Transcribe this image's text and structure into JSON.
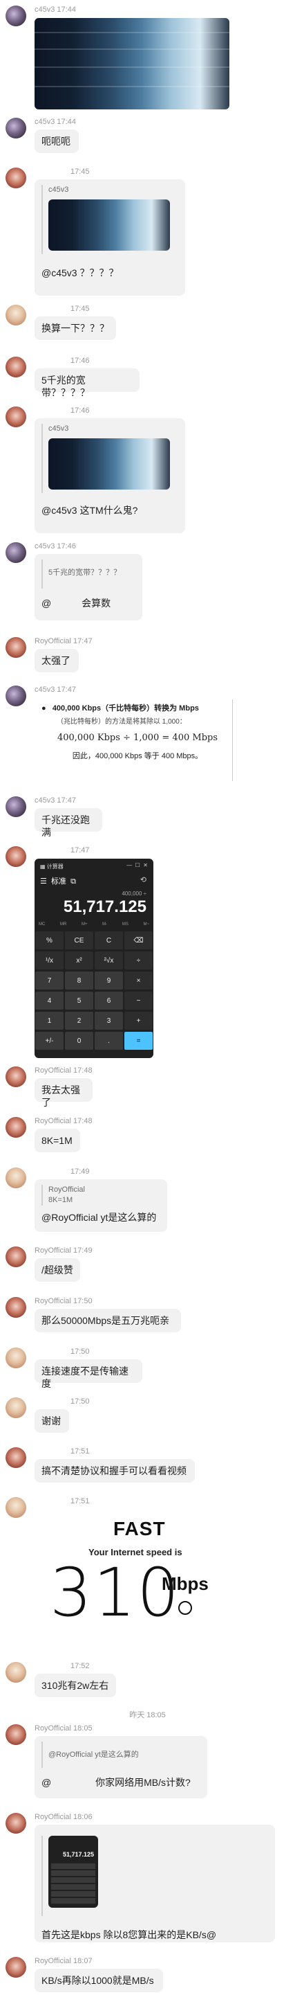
{
  "messages": {
    "m1": {
      "meta": "c45v3 17:44"
    },
    "m2": {
      "meta": "c45v3 17:44",
      "text": "呃呃呃"
    },
    "m3": {
      "time": "17:45",
      "quote_user": "c45v3",
      "text": "@c45v3 ？？？？"
    },
    "m4": {
      "time": "17:45",
      "text": "换算一下？？？"
    },
    "m5": {
      "time": "17:46",
      "text": "5千兆的宽带？？？？"
    },
    "m6": {
      "time": "17:46",
      "quote_user": "c45v3",
      "text": "@c45v3 这TM什么鬼?"
    },
    "m7": {
      "meta": "c45v3 17:46",
      "quote_text": "5千兆的宽带？？？？",
      "at": "@",
      "text": "会算数"
    },
    "m8": {
      "meta": "RoyOfficial 17:47",
      "text": "太强了"
    },
    "m9": {
      "meta": "c45v3 17:47",
      "line1": "400,000 Kbps（千比特每秒）转换为 Mbps",
      "line2": "（兆比特每秒）的方法是将其除以 1,000：",
      "formula": "400,000 Kbps ÷ 1,000 = 400 Mbps",
      "conclusion": "因此，400,000 Kbps 等于 400 Mbps。"
    },
    "m10": {
      "meta": "c45v3 17:47",
      "text": "千兆还没跑满"
    },
    "m11": {
      "time": "17:47",
      "calc_title": "计算器",
      "calc_mode": "标准",
      "calc_expr": "400,000 ÷",
      "calc_display": "51,717.125",
      "calc_memory": [
        "MC",
        "MR",
        "M+",
        "M-",
        "MS",
        "M~"
      ],
      "calc_keys": [
        [
          "%",
          "CE",
          "C",
          "⌫"
        ],
        [
          "¹/x",
          "x²",
          "²√x",
          "÷"
        ],
        [
          "7",
          "8",
          "9",
          "×"
        ],
        [
          "4",
          "5",
          "6",
          "−"
        ],
        [
          "1",
          "2",
          "3",
          "+"
        ],
        [
          "+/-",
          "0",
          ".",
          "="
        ]
      ]
    },
    "m12": {
      "meta": "RoyOfficial 17:48",
      "text": "我去太强了"
    },
    "m13": {
      "meta": "RoyOfficial 17:48",
      "text": "8K=1M"
    },
    "m14": {
      "time": "17:49",
      "quote_user": "RoyOfficial",
      "quote_text": "8K=1M",
      "text": "@RoyOfficial yt是这么算的"
    },
    "m15": {
      "meta": "RoyOfficial 17:49",
      "text": "/超级赞"
    },
    "m16": {
      "meta": "RoyOfficial 17:50",
      "text": "那么50000Mbps是五万兆呃亲"
    },
    "m17": {
      "time": "17:50",
      "text": "连接速度不是传输速度"
    },
    "m18": {
      "time": "17:50",
      "text": "谢谢"
    },
    "m19": {
      "time": "17:51",
      "text": "搞不清楚协议和握手可以看看视频"
    },
    "m20": {
      "time": "17:51",
      "fast_logo": "FAST",
      "fast_label": "Your Internet speed is",
      "fast_value": "310",
      "fast_unit": "Mbps"
    },
    "m21": {
      "time": "17:52",
      "text": "310兆有2w左右"
    },
    "sep": {
      "text": "昨天 18:05"
    },
    "m22": {
      "meta": "RoyOfficial 18:05",
      "quote_text": "@RoyOfficial yt是这么算的",
      "at": "@",
      "text": "你家网络用MB/s计数?"
    },
    "m23": {
      "meta": "RoyOfficial 18:06",
      "text": "首先这是kbps 除以8您算出来的是KB/s@"
    },
    "m24": {
      "meta": "RoyOfficial 18:07",
      "text": "KB/s再除以1000就是MB/s"
    }
  }
}
